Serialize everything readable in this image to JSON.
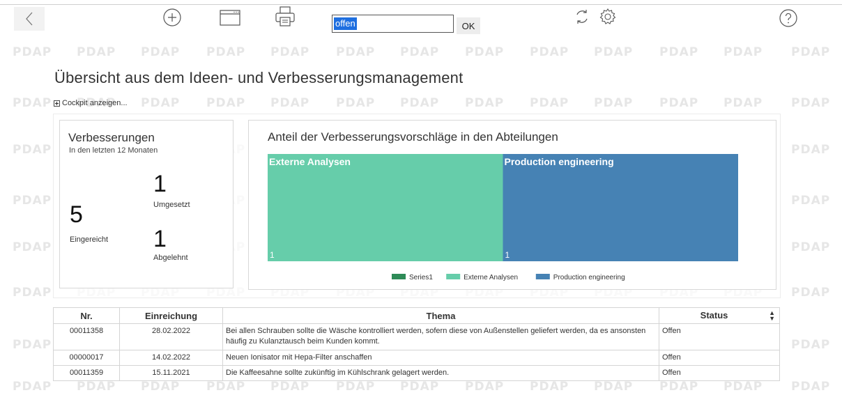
{
  "toolbar": {
    "search_value": "offen",
    "ok_label": "OK"
  },
  "watermark_text": "PDAP",
  "page_title": "Übersicht aus dem Ideen- und Verbesserungsmanagement",
  "cockpit_toggle_label": "Cockpit anzeigen...",
  "kpi": {
    "title": "Verbesserungen",
    "subtitle": "In den letzten 12 Monaten",
    "submitted": {
      "value": "5",
      "label": "Eingereicht"
    },
    "implemented": {
      "value": "1",
      "label": "Umgesetzt"
    },
    "rejected": {
      "value": "1",
      "label": "Abgelehnt"
    }
  },
  "chart_data": {
    "type": "treemap",
    "title": "Anteil der Verbesserungsvorschläge in den Abteilungen",
    "tiles": [
      {
        "name": "Externe Analysen",
        "value": 1,
        "color": "#66cdaa"
      },
      {
        "name": "Production engineering",
        "value": 1,
        "color": "#4682b4"
      }
    ],
    "legend": [
      {
        "name": "Series1",
        "color": "#2e8b57"
      },
      {
        "name": "Externe Analysen",
        "color": "#66cdaa"
      },
      {
        "name": "Production engineering",
        "color": "#4682b4"
      }
    ],
    "legend_position": "bottom"
  },
  "table": {
    "columns": [
      "Nr.",
      "Einreichung",
      "Thema",
      "Status"
    ],
    "rows": [
      [
        "00011358",
        "28.02.2022",
        "Bei allen Schrauben sollte die Wäsche kontrolliert werden, sofern diese von Außenstellen geliefert werden, da es ansonsten häufig zu Kulanztausch beim Kunden kommt.",
        "Offen"
      ],
      [
        "00000017",
        "14.02.2022",
        "Neuen Ionisator mit Hepa-Filter anschaffen",
        "Offen"
      ],
      [
        "00011359",
        "15.11.2021",
        "Die Kaffeesahne sollte zukünftig im Kühlschrank gelagert werden.",
        "Offen"
      ]
    ]
  },
  "icons": [
    "back-icon",
    "add-icon",
    "window-icon",
    "print-icon",
    "refresh-icon",
    "settings-icon",
    "help-icon",
    "sort-icon"
  ]
}
